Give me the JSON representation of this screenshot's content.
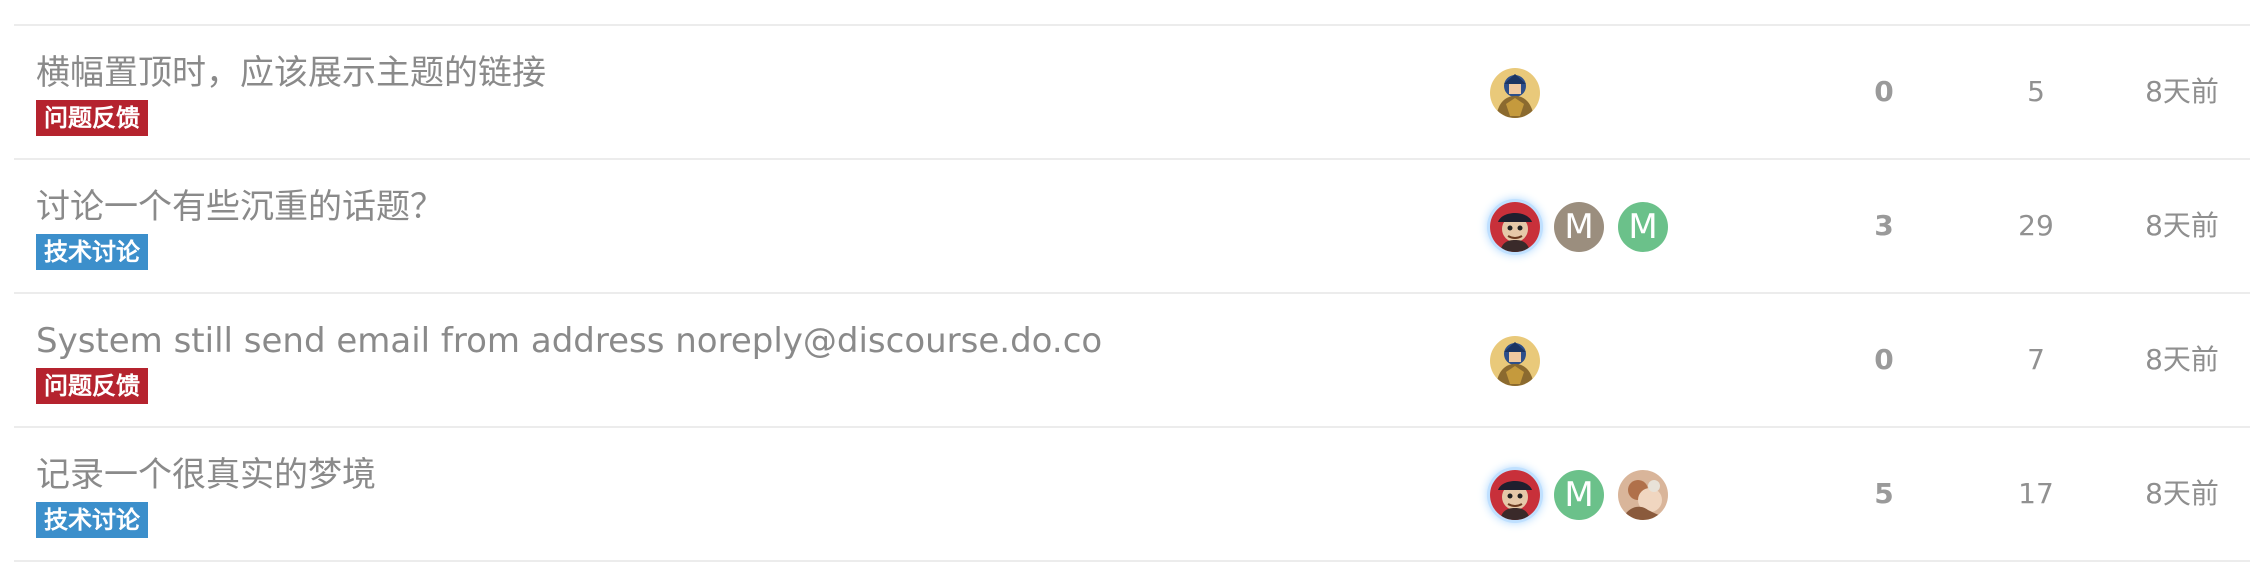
{
  "colors": {
    "feedback_category": "#b5232e",
    "tech_category": "#3c8fcb",
    "avatar_letter_gray": "#9b8e7e",
    "avatar_letter_green": "#6bc18a",
    "divider": "#ececec"
  },
  "topics": [
    {
      "title": "横幅置顶时，应该展示主题的链接",
      "category": "问题反馈",
      "replies": "0",
      "views": "5",
      "activity": "8天前",
      "posters": [
        "avatar-knight-icon"
      ]
    },
    {
      "title": "讨论一个有些沉重的话题？",
      "category": "技术讨论",
      "replies": "3",
      "views": "29",
      "activity": "8天前",
      "posters": [
        "avatar-pirate-icon",
        "M",
        "M"
      ]
    },
    {
      "title": "System still send email from address noreply@discourse.do.co",
      "category": "问题反馈",
      "replies": "0",
      "views": "7",
      "activity": "8天前",
      "posters": [
        "avatar-knight-icon"
      ]
    },
    {
      "title": "记录一个很真实的梦境",
      "category": "技术讨论",
      "replies": "5",
      "views": "17",
      "activity": "8天前",
      "posters": [
        "avatar-pirate-icon",
        "M",
        "avatar-photo-icon"
      ]
    }
  ]
}
